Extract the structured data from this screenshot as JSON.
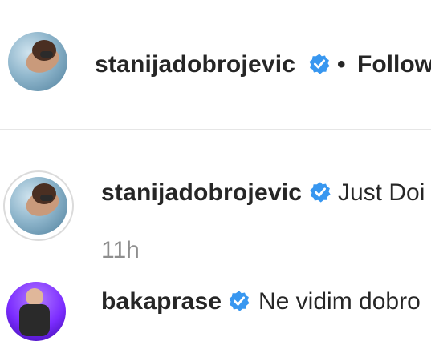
{
  "header": {
    "username": "stanijadobrojevic",
    "separator": "•",
    "follow_label": "Follow"
  },
  "comments": [
    {
      "username": "stanijadobrojevic",
      "text": "Just Doi",
      "time": "11h"
    },
    {
      "username": "bakaprase",
      "text": "Ne vidim dobro"
    }
  ],
  "colors": {
    "verified_blue": "#3897f0",
    "text": "#262626",
    "muted": "#8e8e8e"
  },
  "icons": {
    "verified": "verified-badge-icon"
  }
}
